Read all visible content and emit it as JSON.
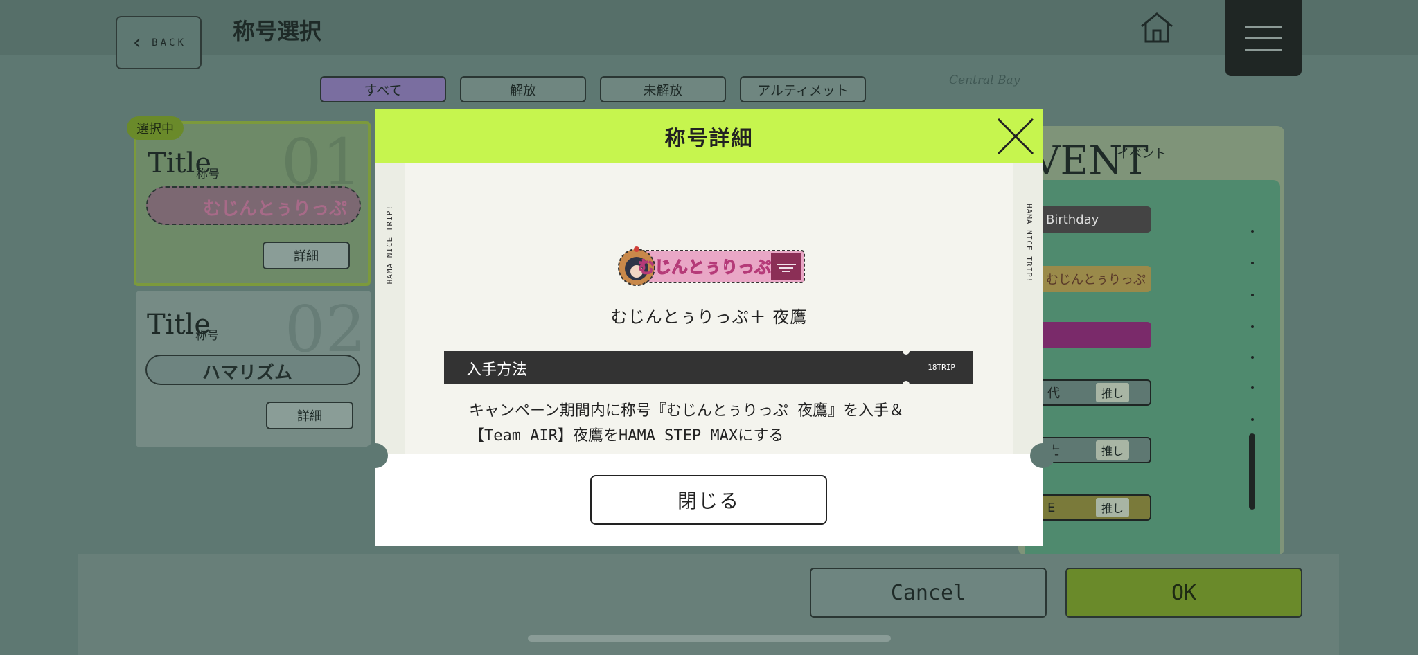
{
  "header": {
    "back_label": "BACK",
    "page_title": "称号選択",
    "map_label": "Central Bay"
  },
  "filters": [
    {
      "label": "すべて",
      "active": true
    },
    {
      "label": "解放",
      "active": false
    },
    {
      "label": "未解放",
      "active": false
    },
    {
      "label": "アルティメット",
      "active": false
    }
  ],
  "cards": [
    {
      "badge": "選択中",
      "number": "01",
      "title": "Title",
      "title_sub": "称号",
      "plate_text": "むじんとぅりっぷ",
      "detail_label": "詳細"
    },
    {
      "number": "02",
      "title": "Title",
      "title_sub": "称号",
      "plate_text": "ハマリズム",
      "detail_label": "詳細"
    }
  ],
  "event_panel": {
    "heading": "VENT",
    "sub": "イベント",
    "rows": [
      {
        "text": "Birthday",
        "tag": ""
      },
      {
        "text": "むじんとぅりっぷ",
        "tag": ""
      },
      {
        "text": "",
        "tag": ""
      },
      {
        "text": "代",
        "tag": "推し"
      },
      {
        "text": "士",
        "tag": "推し"
      },
      {
        "text": "E",
        "tag": "推し"
      }
    ]
  },
  "footer": {
    "cancel_label": "Cancel",
    "ok_label": "OK"
  },
  "modal": {
    "title": "称号詳細",
    "side_text": "HAMA NICE TRIP!",
    "plate_text": "むじんとぅりっぷ",
    "name": "むじんとぅりっぷ＋ 夜鷹",
    "acquisition_label": "入手方法",
    "acquisition_tag": "18TRIP",
    "acquisition_desc": [
      "キャンペーン期間内に称号『むじんとぅりっぷ 夜鷹』を入手＆",
      "【Team AIR】夜鷹をHAMA STEP MAXにする"
    ],
    "close_label": "閉じる"
  },
  "colors": {
    "modal_header": "#c6f54e",
    "acquisition_bar": "#333333",
    "ok_button": "#6a8a2a",
    "active_filter": "#7a6ea0",
    "plate_pink": "#e9a7c6",
    "plate_maroon": "#8b2f56"
  }
}
